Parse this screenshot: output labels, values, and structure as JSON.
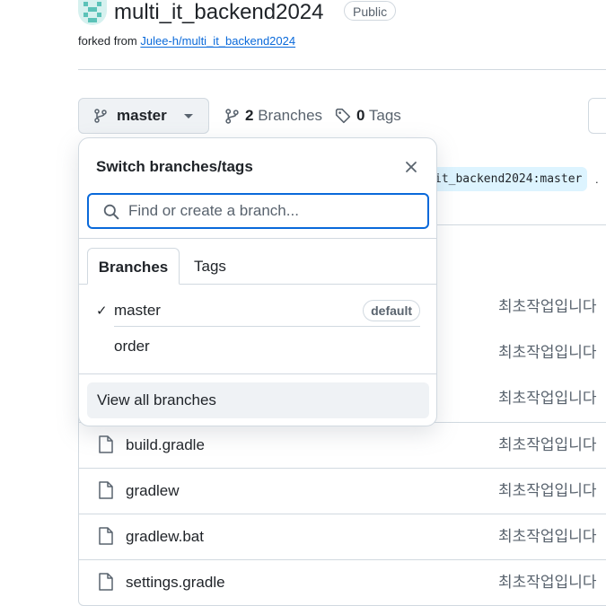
{
  "repo": {
    "name": "multi_it_backend2024",
    "visibility": "Public",
    "forked_prefix": "forked from",
    "forked_from": "Julee-h/multi_it_backend2024"
  },
  "toolbar": {
    "current_branch": "master",
    "branches_count": "2",
    "branches_label": "Branches",
    "tags_count": "0",
    "tags_label": "Tags"
  },
  "compare": {
    "ref_text": "it_backend2024:master",
    "trailing": "."
  },
  "popover": {
    "title": "Switch branches/tags",
    "search_placeholder": "Find or create a branch...",
    "tabs": [
      "Branches",
      "Tags"
    ],
    "branches": [
      {
        "name": "master",
        "checked": true,
        "badge": "default"
      },
      {
        "name": "order",
        "checked": false,
        "badge": ""
      }
    ],
    "view_all": "View all branches",
    "check_glyph": "✓"
  },
  "files": {
    "hidden_row_commits": [
      "최초작업입니다",
      "최초작업입니다",
      "최초작업입니다"
    ],
    "rows": [
      {
        "name": "build.gradle",
        "commit": "최초작업입니다"
      },
      {
        "name": "gradlew",
        "commit": "최초작업입니다"
      },
      {
        "name": "gradlew.bat",
        "commit": "최초작업입니다"
      },
      {
        "name": "settings.gradle",
        "commit": "최초작업입니다"
      }
    ]
  },
  "icons": {
    "branch": "git-branch-icon",
    "tag": "tag-icon",
    "file": "file-icon",
    "search": "search-icon",
    "close": "close-icon"
  },
  "colors": {
    "accent": "#0969da",
    "border": "#d1d9e0",
    "muted": "#59636e",
    "chip": "#ddf4ff"
  }
}
